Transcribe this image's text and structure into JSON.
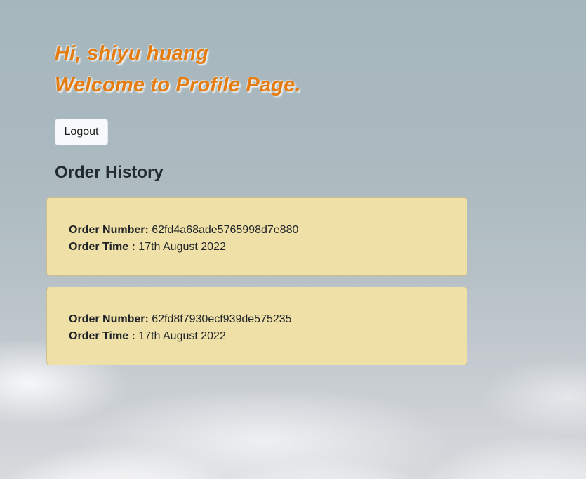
{
  "header": {
    "greeting_line": "Hi, shiyu huang",
    "welcome_line": "Welcome to Profile Page."
  },
  "actions": {
    "logout_label": "Logout"
  },
  "orders": {
    "title": "Order History",
    "number_label": "Order Number:",
    "time_label": "Order Time :",
    "items": [
      {
        "number": "62fd4a68ade5765998d7e880",
        "time": "17th August 2022"
      },
      {
        "number": "62fd8f7930ecf939de575235",
        "time": "17th August 2022"
      }
    ]
  },
  "colors": {
    "greeting_text": "#e57c10",
    "order_card_bg": "#efe0a8",
    "background_sky": "#a5b7bd"
  }
}
